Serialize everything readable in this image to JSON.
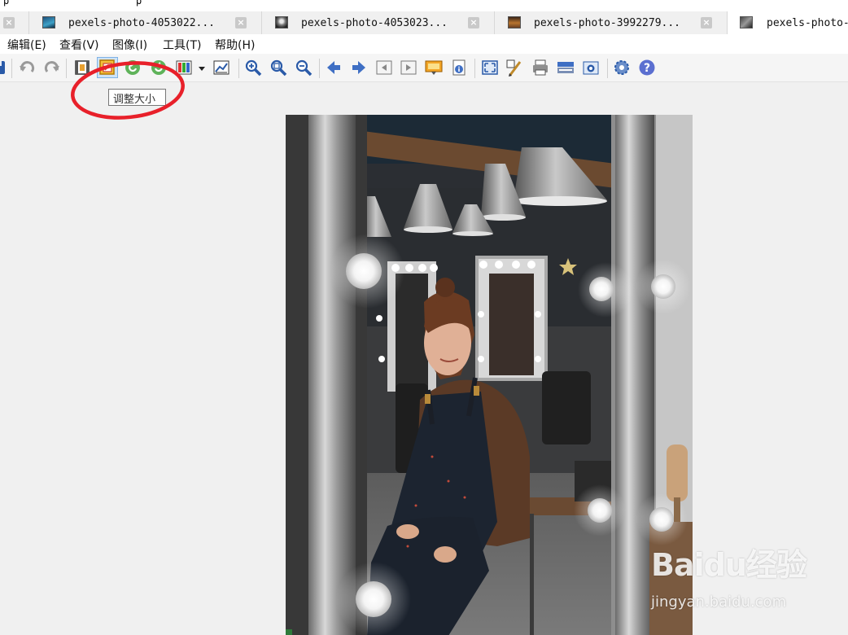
{
  "top_strip": {
    "fragments": [
      "p",
      "p"
    ]
  },
  "tabs": [
    {
      "title": "",
      "close": "×",
      "state": "partial"
    },
    {
      "title": "pexels-photo-4053022...",
      "close": "×",
      "state": "inactive"
    },
    {
      "title": "pexels-photo-4053023...",
      "close": "×",
      "state": "inactive"
    },
    {
      "title": "pexels-photo-3992279...",
      "close": "×",
      "state": "inactive"
    },
    {
      "title": "pexels-photo-",
      "close": "",
      "state": "active"
    }
  ],
  "menu": [
    {
      "label": "编辑(E)"
    },
    {
      "label": "查看(V)"
    },
    {
      "label": "图像(I)"
    },
    {
      "label": "工具(T)"
    },
    {
      "label": "帮助(H)"
    }
  ],
  "toolbar_icons": [
    "save-icon",
    "undo-icon",
    "redo-icon",
    "crop-icon",
    "resize-icon",
    "rotate-left-icon",
    "rotate-right-icon",
    "color-palette-icon",
    "dropdown-arrow-icon",
    "chart-icon",
    "zoom-in-icon",
    "zoom-fit-icon",
    "zoom-out-icon",
    "prev-arrow-icon",
    "next-arrow-icon",
    "first-page-icon",
    "last-page-icon",
    "slideshow-icon",
    "info-icon",
    "fullscreen-icon",
    "paint-icon",
    "print-icon",
    "scanner-icon",
    "camera-icon",
    "settings-gear-icon",
    "help-icon"
  ],
  "tooltip": {
    "text": "调整大小"
  },
  "colors": {
    "annotation_circle": "#e8202a",
    "tab_active": "#ffffff",
    "toolbar_bg": "#f5f5f5",
    "icon_blue": "#2a5aa8"
  },
  "photo": {
    "description_icon": "photo-image"
  },
  "watermark": {
    "brand": "Baidu经验",
    "url": "jingyan.baidu.com"
  }
}
